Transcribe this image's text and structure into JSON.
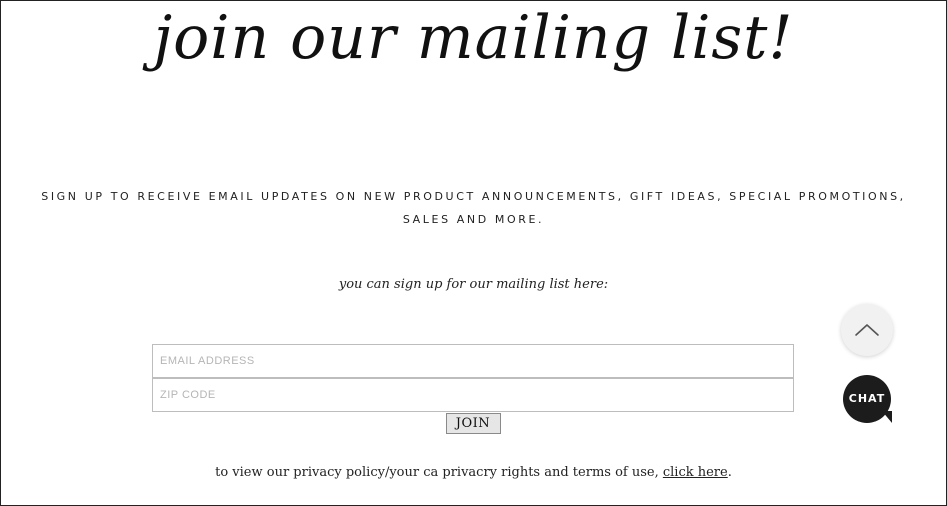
{
  "headline": "join our mailing list!",
  "subhead": "SIGN UP TO RECEIVE EMAIL UPDATES ON NEW PRODUCT ANNOUNCEMENTS, GIFT IDEAS, SPECIAL PROMOTIONS, SALES AND MORE.",
  "signup_line": "you can sign up for our mailing list here:",
  "form": {
    "email_placeholder": "EMAIL ADDRESS",
    "email_value": "",
    "zip_placeholder": "ZIP CODE",
    "zip_value": "",
    "join_label": "JOIN"
  },
  "privacy": {
    "text": "to view our privacy policy/your ca privacry rights and terms of use, ",
    "link_label": "click here",
    "suffix": "."
  },
  "widgets": {
    "scroll_top_icon": "chevron-up-icon",
    "chat_label": "CHAT",
    "chat_color": "#1c1c1c"
  }
}
